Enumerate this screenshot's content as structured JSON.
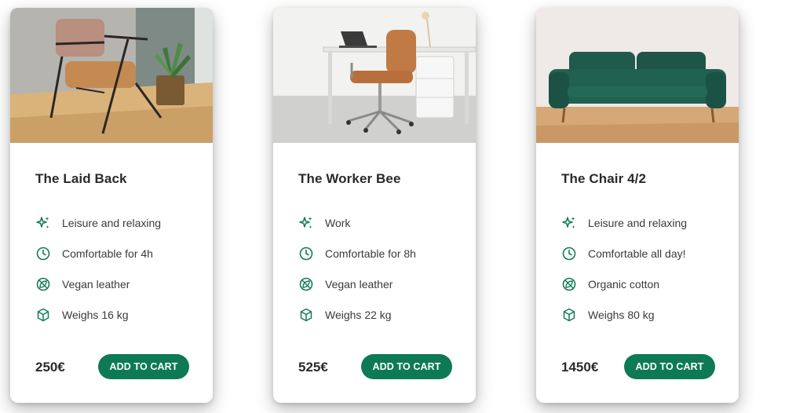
{
  "theme": {
    "accent": "#0d7a55",
    "icon_color": "#137a57",
    "text_color": "#2a2a2a"
  },
  "products": [
    {
      "title": "The Laid Back",
      "features": [
        {
          "icon": "sparkles-icon",
          "text": "Leisure and relaxing"
        },
        {
          "icon": "clock-icon",
          "text": "Comfortable for 4h"
        },
        {
          "icon": "leaf-circle-icon",
          "text": "Vegan leather"
        },
        {
          "icon": "box-icon",
          "text": "Weighs 16 kg"
        }
      ],
      "price": "250€",
      "button_label": "ADD TO CART"
    },
    {
      "title": "The Worker Bee",
      "features": [
        {
          "icon": "sparkles-icon",
          "text": "Work"
        },
        {
          "icon": "clock-icon",
          "text": "Comfortable for 8h"
        },
        {
          "icon": "leaf-circle-icon",
          "text": "Vegan leather"
        },
        {
          "icon": "box-icon",
          "text": "Weighs 22 kg"
        }
      ],
      "price": "525€",
      "button_label": "ADD TO CART"
    },
    {
      "title": "The Chair 4/2",
      "features": [
        {
          "icon": "sparkles-icon",
          "text": "Leisure and relaxing"
        },
        {
          "icon": "clock-icon",
          "text": "Comfortable all day!"
        },
        {
          "icon": "leaf-circle-icon",
          "text": "Organic cotton"
        },
        {
          "icon": "box-icon",
          "text": "Weighs 80 kg"
        }
      ],
      "price": "1450€",
      "button_label": "ADD TO CART"
    }
  ]
}
